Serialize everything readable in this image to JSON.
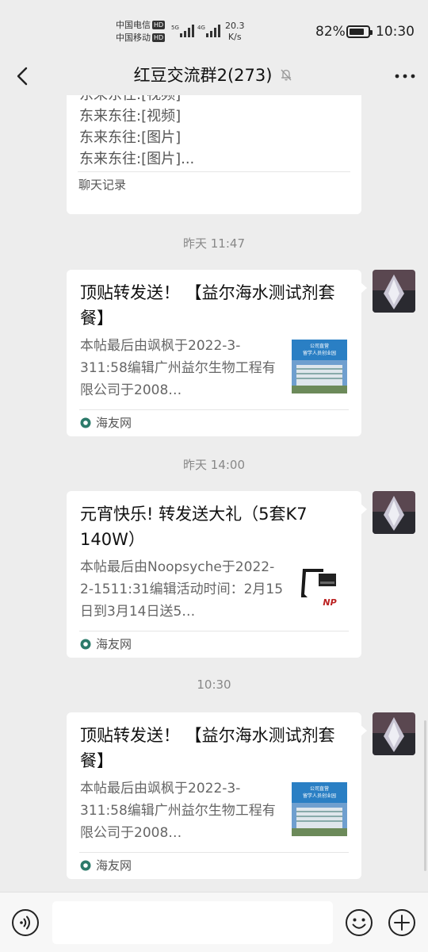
{
  "status_bar": {
    "carrier1": "中国电信",
    "carrier2": "中国移动",
    "hd": "HD",
    "sig1_label": "5G",
    "sig2_label": "4G",
    "net_speed_value": "20.3",
    "net_speed_unit": "K/s",
    "battery": "82%",
    "battery_level": 0.82,
    "time": "10:30"
  },
  "header": {
    "title": "红豆交流群2(273)",
    "muted_icon": "bell-off-icon",
    "more_icon": "more-icon",
    "back_icon": "back-arrow-icon"
  },
  "chat": {
    "forwarded_card": {
      "lines": [
        "东来东往:[视频]",
        "东来东往:[视频]",
        "东来东往:[图片]",
        "东来东往:[图片]..."
      ],
      "footer": "聊天记录"
    },
    "messages": [
      {
        "time": "昨天 11:47",
        "title": "顶贴转发送！ 【益尔海水测试剂套餐】",
        "desc": "本帖最后由飒枫于2022-3-311:58编辑广州益尔生物工程有限公司于2008…",
        "thumb_text1": "公司直营",
        "thumb_text2": "留学人员创业园",
        "source": "海友网"
      },
      {
        "time": "昨天 14:00",
        "title": "元宵快乐! 转发送大礼（5套K7 140W）",
        "desc": "本帖最后由Noopsyche于2022-2-1511:31编辑活动时间：2月15日到3月14日送5…",
        "thumb_text1": "NP",
        "thumb_text2": "",
        "source": "海友网"
      },
      {
        "time": "10:30",
        "title": "顶贴转发送！ 【益尔海水测试剂套餐】",
        "desc": "本帖最后由飒枫于2022-3-311:58编辑广州益尔生物工程有限公司于2008…",
        "thumb_text1": "公司直营",
        "thumb_text2": "留学人员创业园",
        "source": "海友网"
      }
    ]
  },
  "input_bar": {
    "placeholder": "",
    "voice_icon": "voice-icon",
    "emoji_icon": "emoji-icon",
    "plus_icon": "plus-icon"
  }
}
